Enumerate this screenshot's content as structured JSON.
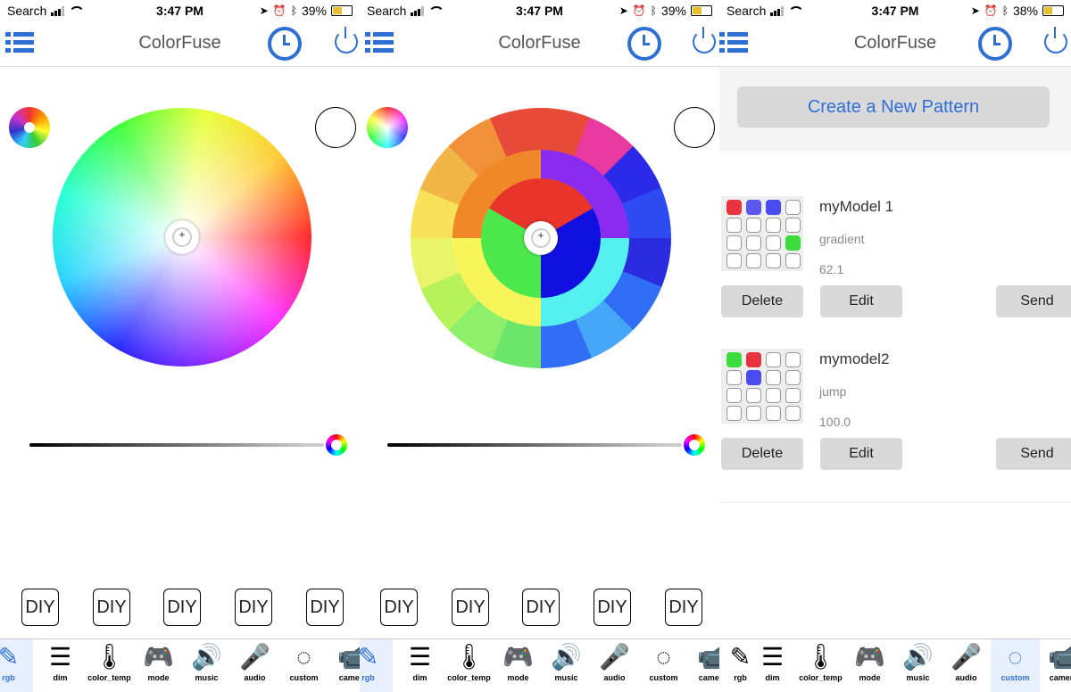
{
  "screens": [
    {
      "status": {
        "carrier": "Search",
        "time": "3:47 PM",
        "battery": "39%"
      },
      "nav": {
        "title": "ColorFuse"
      },
      "diy": [
        "DIY",
        "DIY",
        "DIY",
        "DIY",
        "DIY"
      ],
      "tabs": [
        {
          "icon": "brush-icon",
          "glyph": "✎",
          "label": "rgb"
        },
        {
          "icon": "sliders-icon",
          "glyph": "☰",
          "label": "dim"
        },
        {
          "icon": "thermometer-icon",
          "glyph": "🌡",
          "label": "color_temp"
        },
        {
          "icon": "gamepad-icon",
          "glyph": "🎮",
          "label": "mode"
        },
        {
          "icon": "speaker-icon",
          "glyph": "🔊",
          "label": "music"
        },
        {
          "icon": "microphone-icon",
          "glyph": "🎤",
          "label": "audio"
        },
        {
          "icon": "dotted-circle-icon",
          "glyph": "◌",
          "label": "custom"
        },
        {
          "icon": "camera-icon",
          "glyph": "📹",
          "label": "camera"
        }
      ],
      "active_tab": "rgb"
    },
    {
      "status": {
        "carrier": "Search",
        "time": "3:47 PM",
        "battery": "39%"
      },
      "nav": {
        "title": "ColorFuse"
      },
      "diy": [
        "DIY",
        "DIY",
        "DIY",
        "DIY",
        "DIY"
      ],
      "tabs": [
        {
          "icon": "brush-icon",
          "glyph": "✎",
          "label": "rgb"
        },
        {
          "icon": "sliders-icon",
          "glyph": "☰",
          "label": "dim"
        },
        {
          "icon": "thermometer-icon",
          "glyph": "🌡",
          "label": "color_temp"
        },
        {
          "icon": "gamepad-icon",
          "glyph": "🎮",
          "label": "mode"
        },
        {
          "icon": "speaker-icon",
          "glyph": "🔊",
          "label": "music"
        },
        {
          "icon": "microphone-icon",
          "glyph": "🎤",
          "label": "audio"
        },
        {
          "icon": "dotted-circle-icon",
          "glyph": "◌",
          "label": "custom"
        },
        {
          "icon": "camera-icon",
          "glyph": "📹",
          "label": "camera"
        }
      ],
      "active_tab": "rgb"
    },
    {
      "status": {
        "carrier": "Search",
        "time": "3:47 PM",
        "battery": "38%"
      },
      "nav": {
        "title": "ColorFuse"
      },
      "create_button": "Create a New Pattern",
      "patterns": [
        {
          "name": "myModel 1",
          "mode": "gradient",
          "speed": "62.1",
          "cells": [
            "#e8343f",
            "#5a58ef",
            "#4a4cef",
            "#ffffff",
            "#ffffff",
            "#ffffff",
            "#ffffff",
            "#ffffff",
            "#ffffff",
            "#ffffff",
            "#ffffff",
            "#3ddc3d",
            "#ffffff",
            "#ffffff",
            "#ffffff",
            "#ffffff"
          ],
          "delete": "Delete",
          "edit": "Edit",
          "send": "Send"
        },
        {
          "name": "mymodel2",
          "mode": "jump",
          "speed": "100.0",
          "cells": [
            "#3ddc3d",
            "#e8343f",
            "#ffffff",
            "#ffffff",
            "#ffffff",
            "#4a4cef",
            "#ffffff",
            "#ffffff",
            "#ffffff",
            "#ffffff",
            "#ffffff",
            "#ffffff",
            "#ffffff",
            "#ffffff",
            "#ffffff",
            "#ffffff"
          ],
          "delete": "Delete",
          "edit": "Edit",
          "send": "Send"
        }
      ],
      "tabs": [
        {
          "icon": "brush-icon",
          "glyph": "✎",
          "label": "rgb"
        },
        {
          "icon": "sliders-icon",
          "glyph": "☰",
          "label": "dim"
        },
        {
          "icon": "thermometer-icon",
          "glyph": "🌡",
          "label": "color_temp"
        },
        {
          "icon": "gamepad-icon",
          "glyph": "🎮",
          "label": "mode"
        },
        {
          "icon": "speaker-icon",
          "glyph": "🔊",
          "label": "music"
        },
        {
          "icon": "microphone-icon",
          "glyph": "🎤",
          "label": "audio"
        },
        {
          "icon": "dotted-circle-icon",
          "glyph": "◌",
          "label": "custom"
        },
        {
          "icon": "camera-icon",
          "glyph": "📹",
          "label": "camera"
        }
      ],
      "active_tab": "custom"
    }
  ],
  "colors": {
    "accent": "#2e6fd6",
    "create_text": "#2e6fd6"
  }
}
